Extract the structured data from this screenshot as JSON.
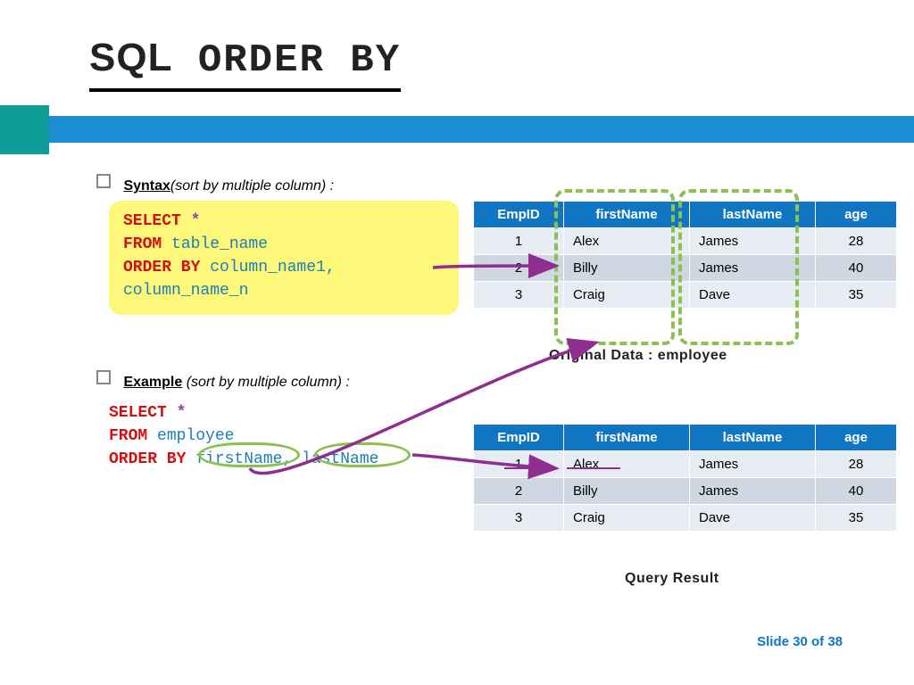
{
  "title": {
    "sql": "SQL",
    "orderby": " ORDER BY"
  },
  "bullets": {
    "syntax": {
      "label": "Syntax",
      "sub": "(sort by multiple column) :"
    },
    "example": {
      "label": "Example",
      "sub": " (sort by multiple column) :"
    }
  },
  "code_syntax": {
    "l1": {
      "select": "SELECT ",
      "star": "*"
    },
    "l2": {
      "from": "FROM ",
      "ident": "table_name"
    },
    "l3": {
      "order": "ORDER BY ",
      "ident": "column_name1,",
      "cont": " column_name_n"
    }
  },
  "code_example": {
    "l1": {
      "select": "SELECT ",
      "star": "*"
    },
    "l2": {
      "from": "FROM ",
      "ident": "employee"
    },
    "l3": {
      "order": "ORDER BY ",
      "c1": "firstName",
      "comma": ", ",
      "c2": "lastName"
    }
  },
  "table_top": {
    "headers": [
      "EmpID",
      "firstName",
      "lastName",
      "age"
    ],
    "rows": [
      [
        "1",
        "Alex",
        "James",
        "28"
      ],
      [
        "2",
        "Billy",
        "James",
        "40"
      ],
      [
        "3",
        "Craig",
        "Dave",
        "35"
      ]
    ],
    "caption": "Original Data : employee"
  },
  "table_bottom": {
    "headers": [
      "EmpID",
      "firstName",
      "lastName",
      "age"
    ],
    "rows": [
      [
        "1",
        "Alex",
        "James",
        "28"
      ],
      [
        "2",
        "Billy",
        "James",
        "40"
      ],
      [
        "3",
        "Craig",
        "Dave",
        "35"
      ]
    ],
    "caption": "Query Result"
  },
  "footer": {
    "text": "Slide 30 of 38"
  }
}
